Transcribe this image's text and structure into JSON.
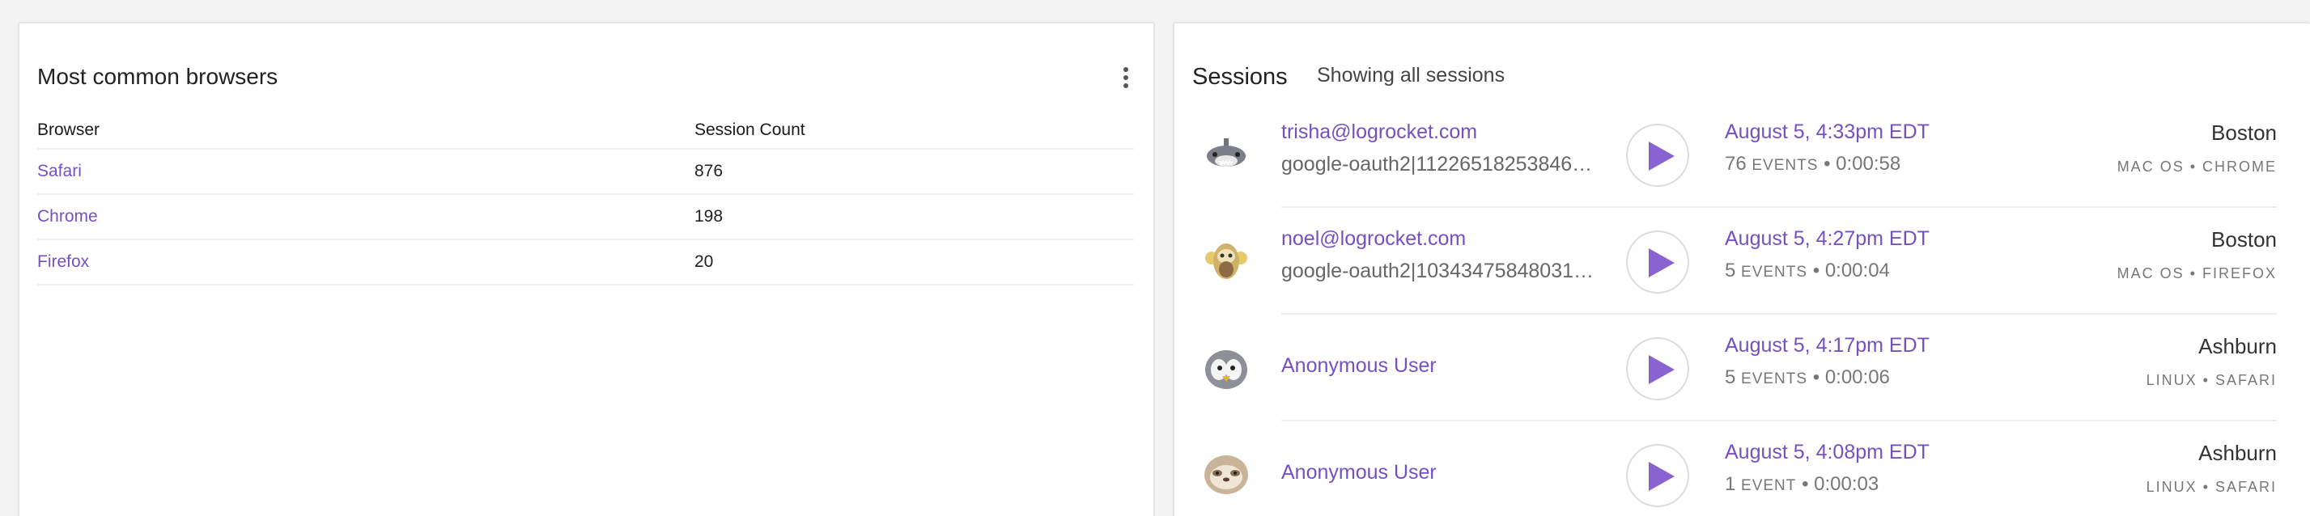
{
  "browsers_card": {
    "title": "Most common browsers",
    "columns": [
      "Browser",
      "Session Count"
    ],
    "rows": [
      {
        "browser": "Safari",
        "count": "876"
      },
      {
        "browser": "Chrome",
        "count": "198"
      },
      {
        "browser": "Firefox",
        "count": "20"
      }
    ]
  },
  "sessions_card": {
    "title": "Sessions",
    "subtitle": "Showing all sessions",
    "sessions": [
      {
        "user": "trisha@logrocket.com",
        "user_id": "google-oauth2|11226518253846…",
        "date": "August 5, 4:33pm EDT",
        "events_count": "76",
        "events_label": "EVENTS",
        "duration": "0:00:58",
        "city": "Boston",
        "platform": "MAC OS • CHROME",
        "avatar": "shark-avatar"
      },
      {
        "user": "noel@logrocket.com",
        "user_id": "google-oauth2|10343475848031…",
        "date": "August 5, 4:27pm EDT",
        "events_count": "5",
        "events_label": "EVENTS",
        "duration": "0:00:04",
        "city": "Boston",
        "platform": "MAC OS • FIREFOX",
        "avatar": "monkey-avatar"
      },
      {
        "user": "Anonymous User",
        "user_id": "",
        "date": "August 5, 4:17pm EDT",
        "events_count": "5",
        "events_label": "EVENTS",
        "duration": "0:00:06",
        "city": "Ashburn",
        "platform": "LINUX • SAFARI",
        "avatar": "penguin-avatar"
      },
      {
        "user": "Anonymous User",
        "user_id": "",
        "date": "August 5, 4:08pm EDT",
        "events_count": "1",
        "events_label": "EVENT",
        "duration": "0:00:03",
        "city": "Ashburn",
        "platform": "LINUX • SAFARI",
        "avatar": "sloth-avatar"
      }
    ]
  },
  "colors": {
    "accent": "#7550c3",
    "play": "#8a63d2",
    "background": "#f3f3f3"
  }
}
